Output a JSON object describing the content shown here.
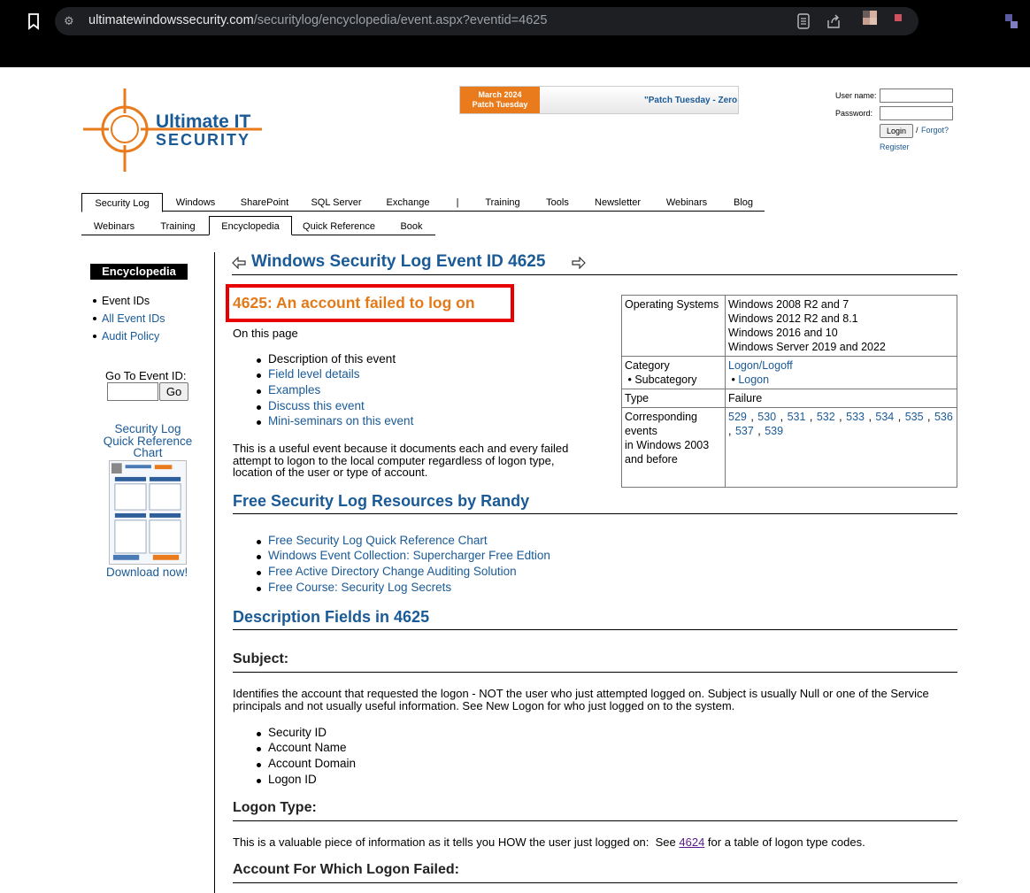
{
  "browser": {
    "url_host": "ultimatewindowssecurity.com",
    "url_path": "/securitylog/encyclopedia/event.aspx?eventid=4625"
  },
  "header": {
    "logo_line1": "Ultimate IT",
    "logo_line2": "SECURITY",
    "banner_left": "March 2024\nPatch Tuesday",
    "banner_right": "\"Patch Tuesday - Zero",
    "login": {
      "username_label": "User name:",
      "password_label": "Password:",
      "login_button": "Login",
      "separator": "/",
      "forgot": "Forgot?",
      "register": "Register"
    }
  },
  "nav": {
    "row1": [
      "Security Log",
      "Windows",
      "SharePoint",
      "SQL Server",
      "Exchange",
      "|",
      "Training",
      "Tools",
      "Newsletter",
      "Webinars",
      "Blog"
    ],
    "row2": [
      "Webinars",
      "Training",
      "Encyclopedia",
      "Quick Reference",
      "Book"
    ]
  },
  "sidebar": {
    "title": "Encyclopedia",
    "items": [
      "Event IDs",
      "All Event IDs",
      "Audit Policy"
    ],
    "goto_label": "Go To Event ID:",
    "goto_button": "Go",
    "qref_title": "Security Log Quick Reference Chart",
    "download": "Download now!"
  },
  "main": {
    "page_title": "Windows Security Log Event ID 4625",
    "event_title": "4625: An account failed to log on",
    "on_this_page": "On this page",
    "toc": [
      "Description of this event",
      "Field level details",
      "Examples",
      "Discuss this event",
      "Mini-seminars on this event"
    ],
    "intro": "This is a useful event because it documents each and every failed attempt to logon to the local computer regardless of logon type, location of the user or type of account.",
    "resources_heading": "Free Security Log Resources by Randy",
    "resources": [
      "Free Security Log Quick Reference Chart",
      "Windows Event Collection: Supercharger Free Edtion",
      "Free Active Directory Change Auditing Solution",
      "Free Course: Security Log Secrets"
    ],
    "desc_heading": "Description Fields in 4625",
    "subject_heading": "Subject:",
    "subject_text": "Identifies the account that requested the logon - NOT the user who just attempted logged on. Subject is usually Null or one of the Service principals and not usually useful information. See New Logon for who just logged on to the system.",
    "subject_fields": [
      "Security ID",
      "Account Name",
      "Account Domain",
      "Logon ID"
    ],
    "logon_type_heading": "Logon Type:",
    "logon_type_text_pre": "This is a valuable piece of information as it tells you HOW the user just logged on:  See ",
    "logon_type_link": "4624",
    "logon_type_text_post": " for a table of logon type codes.",
    "account_failed_heading": "Account For Which Logon Failed:"
  },
  "info_table": {
    "os_label": "Operating Systems",
    "os_values": [
      "Windows 2008 R2 and 7",
      "Windows 2012 R2 and 8.1",
      "Windows 2016 and 10",
      "Windows Server 2019 and 2022"
    ],
    "category_label": "Category",
    "subcategory_label": "Subcategory",
    "category_value": "Logon/Logoff",
    "subcategory_value": "Logon",
    "type_label": "Type",
    "type_value": "Failure",
    "corr_label_1": "Corresponding",
    "corr_label_2": "events",
    "corr_label_3": "in Windows 2003",
    "corr_label_4": "and before",
    "corr_events": [
      "529",
      "530",
      "531",
      "532",
      "533",
      "534",
      "535",
      "536",
      "537",
      "539"
    ]
  },
  "colors": {
    "link": "#1a5a96",
    "orange": "#e27a1a",
    "highlight_box": "#e80000"
  }
}
